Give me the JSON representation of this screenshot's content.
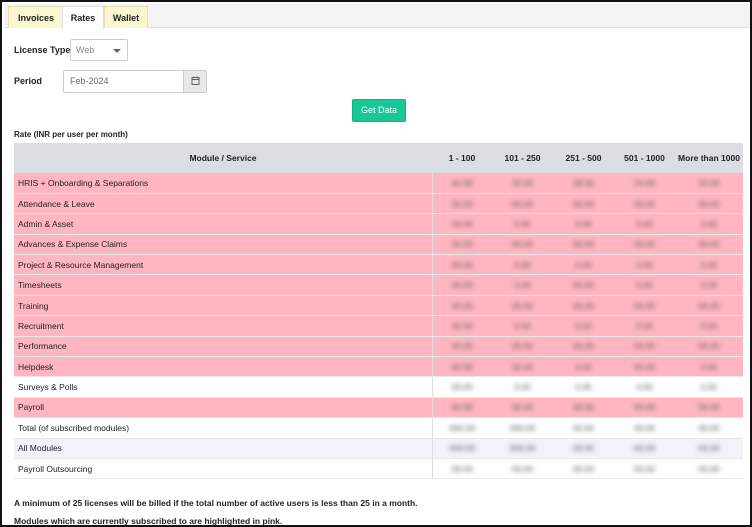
{
  "tabs": [
    {
      "label": "Invoices",
      "active": false
    },
    {
      "label": "Rates",
      "active": true
    },
    {
      "label": "Wallet",
      "active": false
    }
  ],
  "form": {
    "license_type_label": "License Type",
    "license_type_value": "Web",
    "period_label": "Period",
    "period_value": "Feb-2024",
    "get_data_label": "Get Data"
  },
  "table": {
    "caption": "Rate (INR per user per month)",
    "headers": [
      "Module / Service",
      "1 - 100",
      "101 - 250",
      "251 - 500",
      "501 - 1000",
      "More than 1000"
    ],
    "rows": [
      {
        "module": "HRIS + Onboarding & Separations",
        "highlight": "pink",
        "values": [
          "40.00",
          "32.00",
          "28.00",
          "24.00",
          "20.00"
        ]
      },
      {
        "module": "Attendance & Leave",
        "highlight": "pink",
        "values": [
          "00.00",
          "00.00",
          "00.00",
          "00.00",
          "00.00"
        ]
      },
      {
        "module": "Admin & Asset",
        "highlight": "pink",
        "values": [
          "00.00",
          "0.00",
          "0.00",
          "0.00",
          "0.00"
        ]
      },
      {
        "module": "Advances & Expense Claims",
        "highlight": "pink",
        "values": [
          "00.00",
          "00.00",
          "00.00",
          "00.00",
          "00.00"
        ]
      },
      {
        "module": "Project & Resource Management",
        "highlight": "pink",
        "values": [
          "00.00",
          "0.00",
          "0.00",
          "0.00",
          "0.00"
        ]
      },
      {
        "module": "Timesheets",
        "highlight": "pink",
        "values": [
          "00.00",
          "0.00",
          "00.00",
          "0.00",
          "0.00"
        ]
      },
      {
        "module": "Training",
        "highlight": "pink",
        "values": [
          "00.00",
          "00.00",
          "00.00",
          "00.00",
          "00.00"
        ]
      },
      {
        "module": "Recruitment",
        "highlight": "pink",
        "values": [
          "00.00",
          "0.00",
          "0.00",
          "0.00",
          "0.00"
        ]
      },
      {
        "module": "Performance",
        "highlight": "pink",
        "values": [
          "00.00",
          "00.00",
          "00.00",
          "00.00",
          "00.00"
        ]
      },
      {
        "module": "Helpdesk",
        "highlight": "pink",
        "values": [
          "00.00",
          "00.00",
          "0.00",
          "00.00",
          "0.00"
        ]
      },
      {
        "module": "Surveys & Polls",
        "highlight": "white",
        "values": [
          "00.00",
          "0.00",
          "0.00",
          "0.00",
          "0.00"
        ]
      },
      {
        "module": "Payroll",
        "highlight": "pink",
        "values": [
          "00.00",
          "00.00",
          "00.00",
          "00.00",
          "00.00"
        ]
      },
      {
        "module": "Total (of subscribed modules)",
        "highlight": "white",
        "values": [
          "000.00",
          "000.00",
          "00.00",
          "00.00",
          "00.00"
        ]
      },
      {
        "module": "All Modules",
        "highlight": "alt",
        "values": [
          "000.00",
          "000.00",
          "00.00",
          "00.00",
          "00.00"
        ]
      },
      {
        "module": "Payroll Outsourcing",
        "highlight": "white",
        "values": [
          "00.00",
          "00.00",
          "00.00",
          "00.00",
          "00.00"
        ]
      }
    ]
  },
  "notes": [
    "A minimum of 25 licenses will be billed if the total number of active users is less than 25 in a month.",
    "Modules which are currently subscribed to are highlighted in pink."
  ],
  "colors": {
    "tab_bg": "#fbf6cf",
    "highlight_pink": "#ffb6c1",
    "button_green": "#19c795",
    "header_gray": "#dcdde2"
  }
}
